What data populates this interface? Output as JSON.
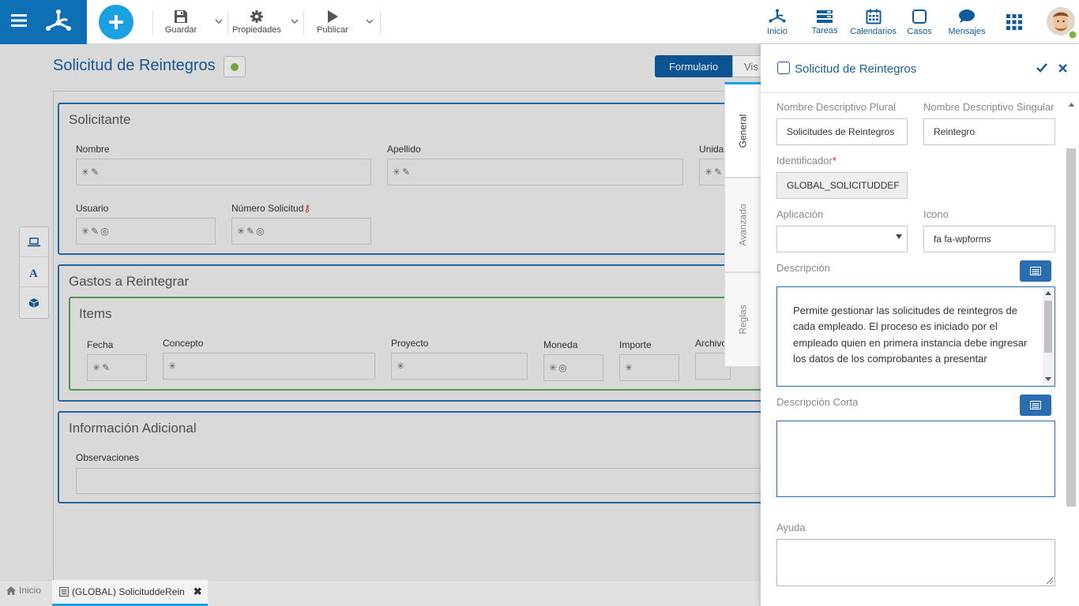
{
  "toolbar": {
    "save": "Guardar",
    "properties": "Propiedades",
    "publish": "Publicar"
  },
  "nav": {
    "inicio": "Inicio",
    "tareas": "Tareas",
    "calendarios": "Calendarios",
    "casos": "Casos",
    "mensajes": "Mensajes"
  },
  "form": {
    "title": "Solicitud de Reintegros",
    "tab_formulario": "Formulario",
    "tab_vista": "Vis",
    "panels": {
      "solicitante": {
        "title": "Solicitante",
        "fields": {
          "nombre": "Nombre",
          "apellido": "Apellido",
          "unidad": "Unida",
          "usuario": "Usuario",
          "numero": "Número Solicitud"
        }
      },
      "gastos": {
        "title": "Gastos a Reintegrar",
        "items_title": "Items",
        "columns": {
          "fecha": "Fecha",
          "concepto": "Concepto",
          "proyecto": "Proyecto",
          "moneda": "Moneda",
          "importe": "Importe",
          "archivo": "Archivo"
        }
      },
      "info": {
        "title": "Información Adicional",
        "observaciones": "Observaciones"
      }
    }
  },
  "bottom": {
    "inicio": "Inicio",
    "tab": "(GLOBAL) SolicituddeRein"
  },
  "vtabs": {
    "general": "General",
    "avanzado": "Avanzado",
    "reglas": "Reglas"
  },
  "props": {
    "title": "Solicitud de Reintegros",
    "plural_label": "Nombre Descriptivo Plural",
    "plural_value": "Solicitudes de Reintegros",
    "singular_label": "Nombre Descriptivo Singular",
    "singular_value": "Reintegro",
    "id_label": "Identificador",
    "id_required": "*",
    "id_value": "GLOBAL_SOLICITUDDEF",
    "app_label": "Aplicación",
    "app_value": "",
    "icon_label": "Icono",
    "icon_value": "fa fa-wpforms",
    "desc_label": "Descripción",
    "desc_value": "Permite gestionar las solicitudes de reintegros de cada empleado. El proceso es iniciado por el empleado quien en primera instancia debe ingresar los datos de los comprobantes a presentar",
    "short_desc_label": "Descripción Corta",
    "help_label": "Ayuda"
  },
  "colors": {
    "brand": "#0e6fb5",
    "accent": "#1ba1e2",
    "panel_border": "#2a6db0",
    "items_border": "#5ba35b"
  }
}
